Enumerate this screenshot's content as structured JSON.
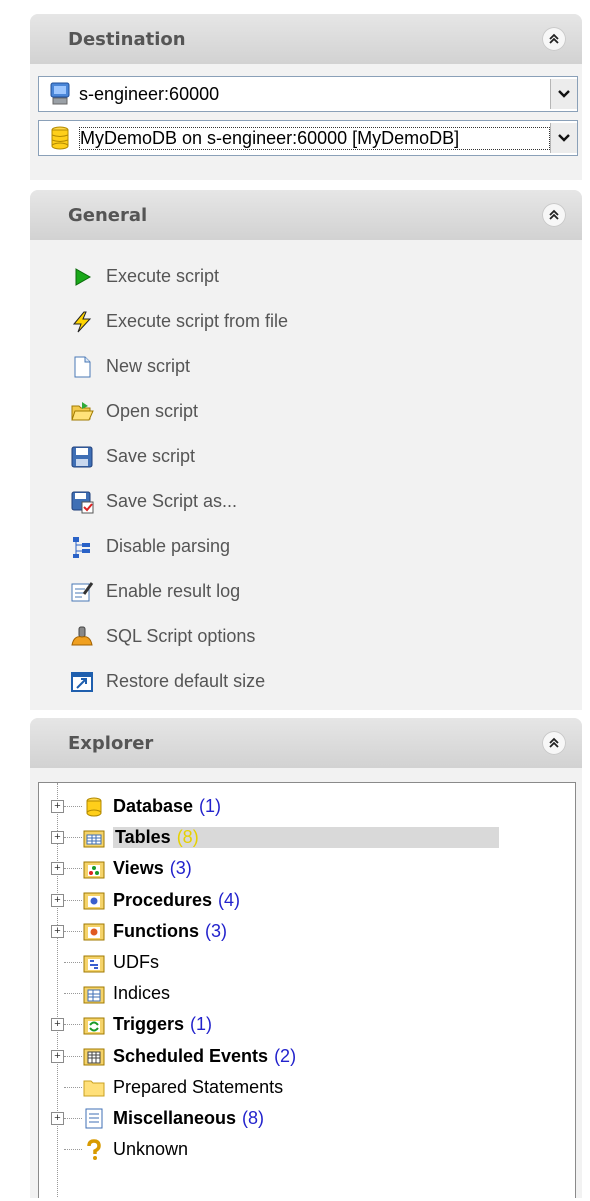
{
  "destination": {
    "title": "Destination",
    "server": "s-engineer:60000",
    "database": "MyDemoDB on s-engineer:60000 [MyDemoDB]"
  },
  "general": {
    "title": "General",
    "items": [
      {
        "label": "Execute script",
        "icon": "play-icon"
      },
      {
        "label": "Execute script from file",
        "icon": "lightning-icon"
      },
      {
        "label": "New script",
        "icon": "document-icon"
      },
      {
        "label": "Open script",
        "icon": "open-folder-icon"
      },
      {
        "label": "Save script",
        "icon": "floppy-icon"
      },
      {
        "label": "Save Script as...",
        "icon": "floppy-as-icon"
      },
      {
        "label": "Disable parsing",
        "icon": "tree-icon"
      },
      {
        "label": "Enable result log",
        "icon": "log-icon"
      },
      {
        "label": "SQL Script options",
        "icon": "options-icon"
      },
      {
        "label": "Restore default size",
        "icon": "restore-icon"
      }
    ]
  },
  "explorer": {
    "title": "Explorer",
    "nodes": [
      {
        "label": "Database",
        "count": "(1)",
        "bold": true,
        "expand": true,
        "icon": "database-icon"
      },
      {
        "label": "Tables",
        "count": "(8)",
        "bold": true,
        "expand": true,
        "icon": "tables-icon",
        "selected": true
      },
      {
        "label": "Views",
        "count": "(3)",
        "bold": true,
        "expand": true,
        "icon": "views-icon"
      },
      {
        "label": "Procedures",
        "count": "(4)",
        "bold": true,
        "expand": true,
        "icon": "procedures-icon"
      },
      {
        "label": "Functions",
        "count": "(3)",
        "bold": true,
        "expand": true,
        "icon": "functions-icon"
      },
      {
        "label": "UDFs",
        "count": "",
        "bold": false,
        "expand": false,
        "icon": "udfs-icon"
      },
      {
        "label": "Indices",
        "count": "",
        "bold": false,
        "expand": false,
        "icon": "indices-icon"
      },
      {
        "label": "Triggers",
        "count": "(1)",
        "bold": true,
        "expand": true,
        "icon": "triggers-icon"
      },
      {
        "label": "Scheduled Events",
        "count": "(2)",
        "bold": true,
        "expand": true,
        "icon": "scheduled-events-icon"
      },
      {
        "label": "Prepared Statements",
        "count": "",
        "bold": false,
        "expand": false,
        "icon": "folder-icon"
      },
      {
        "label": "Miscellaneous",
        "count": "(8)",
        "bold": true,
        "expand": true,
        "icon": "miscellaneous-icon"
      },
      {
        "label": "Unknown",
        "count": "",
        "bold": false,
        "expand": false,
        "icon": "question-icon"
      }
    ]
  }
}
